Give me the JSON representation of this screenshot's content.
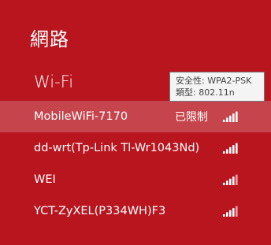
{
  "header": {
    "title": "網路"
  },
  "wifi": {
    "section_label": "Wi-Fi"
  },
  "networks": [
    {
      "name": "MobileWiFi-7170",
      "status": "已限制",
      "signal_bars": 5,
      "selected": true
    },
    {
      "name": "dd-wrt(Tp-Link Tl-Wr1043Nd)",
      "status": "",
      "signal_bars": 5,
      "selected": false
    },
    {
      "name": "WEI",
      "status": "",
      "signal_bars": 4,
      "selected": false
    },
    {
      "name": "YCT-ZyXEL(P334WH)F3",
      "status": "",
      "signal_bars": 4,
      "selected": false
    }
  ],
  "tooltip": {
    "security": "安全性: WPA2-PSK",
    "type": "類型: 802.11n"
  },
  "colors": {
    "background": "#b8151f",
    "selected_row": "#c6454c",
    "text": "#ffffff",
    "signal_dim": "#e7a5a9"
  }
}
